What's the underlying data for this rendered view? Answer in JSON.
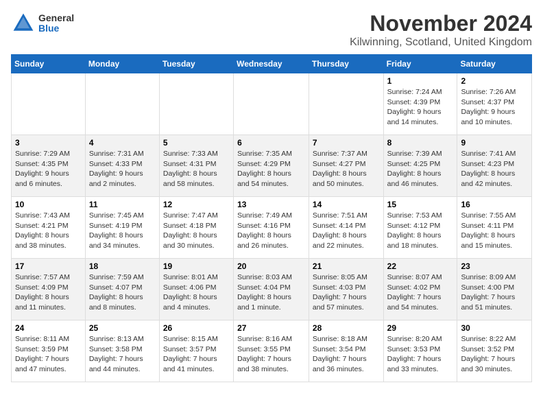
{
  "logo": {
    "general": "General",
    "blue": "Blue"
  },
  "title": "November 2024",
  "location": "Kilwinning, Scotland, United Kingdom",
  "days_of_week": [
    "Sunday",
    "Monday",
    "Tuesday",
    "Wednesday",
    "Thursday",
    "Friday",
    "Saturday"
  ],
  "weeks": [
    [
      {
        "day": "",
        "info": ""
      },
      {
        "day": "",
        "info": ""
      },
      {
        "day": "",
        "info": ""
      },
      {
        "day": "",
        "info": ""
      },
      {
        "day": "",
        "info": ""
      },
      {
        "day": "1",
        "info": "Sunrise: 7:24 AM\nSunset: 4:39 PM\nDaylight: 9 hours and 14 minutes."
      },
      {
        "day": "2",
        "info": "Sunrise: 7:26 AM\nSunset: 4:37 PM\nDaylight: 9 hours and 10 minutes."
      }
    ],
    [
      {
        "day": "3",
        "info": "Sunrise: 7:29 AM\nSunset: 4:35 PM\nDaylight: 9 hours and 6 minutes."
      },
      {
        "day": "4",
        "info": "Sunrise: 7:31 AM\nSunset: 4:33 PM\nDaylight: 9 hours and 2 minutes."
      },
      {
        "day": "5",
        "info": "Sunrise: 7:33 AM\nSunset: 4:31 PM\nDaylight: 8 hours and 58 minutes."
      },
      {
        "day": "6",
        "info": "Sunrise: 7:35 AM\nSunset: 4:29 PM\nDaylight: 8 hours and 54 minutes."
      },
      {
        "day": "7",
        "info": "Sunrise: 7:37 AM\nSunset: 4:27 PM\nDaylight: 8 hours and 50 minutes."
      },
      {
        "day": "8",
        "info": "Sunrise: 7:39 AM\nSunset: 4:25 PM\nDaylight: 8 hours and 46 minutes."
      },
      {
        "day": "9",
        "info": "Sunrise: 7:41 AM\nSunset: 4:23 PM\nDaylight: 8 hours and 42 minutes."
      }
    ],
    [
      {
        "day": "10",
        "info": "Sunrise: 7:43 AM\nSunset: 4:21 PM\nDaylight: 8 hours and 38 minutes."
      },
      {
        "day": "11",
        "info": "Sunrise: 7:45 AM\nSunset: 4:19 PM\nDaylight: 8 hours and 34 minutes."
      },
      {
        "day": "12",
        "info": "Sunrise: 7:47 AM\nSunset: 4:18 PM\nDaylight: 8 hours and 30 minutes."
      },
      {
        "day": "13",
        "info": "Sunrise: 7:49 AM\nSunset: 4:16 PM\nDaylight: 8 hours and 26 minutes."
      },
      {
        "day": "14",
        "info": "Sunrise: 7:51 AM\nSunset: 4:14 PM\nDaylight: 8 hours and 22 minutes."
      },
      {
        "day": "15",
        "info": "Sunrise: 7:53 AM\nSunset: 4:12 PM\nDaylight: 8 hours and 18 minutes."
      },
      {
        "day": "16",
        "info": "Sunrise: 7:55 AM\nSunset: 4:11 PM\nDaylight: 8 hours and 15 minutes."
      }
    ],
    [
      {
        "day": "17",
        "info": "Sunrise: 7:57 AM\nSunset: 4:09 PM\nDaylight: 8 hours and 11 minutes."
      },
      {
        "day": "18",
        "info": "Sunrise: 7:59 AM\nSunset: 4:07 PM\nDaylight: 8 hours and 8 minutes."
      },
      {
        "day": "19",
        "info": "Sunrise: 8:01 AM\nSunset: 4:06 PM\nDaylight: 8 hours and 4 minutes."
      },
      {
        "day": "20",
        "info": "Sunrise: 8:03 AM\nSunset: 4:04 PM\nDaylight: 8 hours and 1 minute."
      },
      {
        "day": "21",
        "info": "Sunrise: 8:05 AM\nSunset: 4:03 PM\nDaylight: 7 hours and 57 minutes."
      },
      {
        "day": "22",
        "info": "Sunrise: 8:07 AM\nSunset: 4:02 PM\nDaylight: 7 hours and 54 minutes."
      },
      {
        "day": "23",
        "info": "Sunrise: 8:09 AM\nSunset: 4:00 PM\nDaylight: 7 hours and 51 minutes."
      }
    ],
    [
      {
        "day": "24",
        "info": "Sunrise: 8:11 AM\nSunset: 3:59 PM\nDaylight: 7 hours and 47 minutes."
      },
      {
        "day": "25",
        "info": "Sunrise: 8:13 AM\nSunset: 3:58 PM\nDaylight: 7 hours and 44 minutes."
      },
      {
        "day": "26",
        "info": "Sunrise: 8:15 AM\nSunset: 3:57 PM\nDaylight: 7 hours and 41 minutes."
      },
      {
        "day": "27",
        "info": "Sunrise: 8:16 AM\nSunset: 3:55 PM\nDaylight: 7 hours and 38 minutes."
      },
      {
        "day": "28",
        "info": "Sunrise: 8:18 AM\nSunset: 3:54 PM\nDaylight: 7 hours and 36 minutes."
      },
      {
        "day": "29",
        "info": "Sunrise: 8:20 AM\nSunset: 3:53 PM\nDaylight: 7 hours and 33 minutes."
      },
      {
        "day": "30",
        "info": "Sunrise: 8:22 AM\nSunset: 3:52 PM\nDaylight: 7 hours and 30 minutes."
      }
    ]
  ]
}
